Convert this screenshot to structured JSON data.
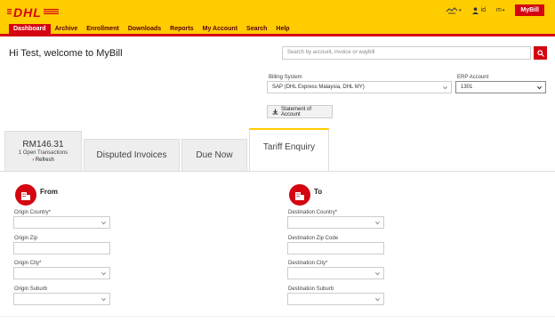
{
  "brand": {
    "logo_text": "DHL",
    "accent": "#d40511",
    "yellow": "#ffcc00"
  },
  "header": {
    "user_label": "id",
    "lang_label": "m",
    "mybill_label": "MyBill"
  },
  "nav": {
    "items": [
      {
        "label": "Dashboard"
      },
      {
        "label": "Archive"
      },
      {
        "label": "Enrollment"
      },
      {
        "label": "Downloads"
      },
      {
        "label": "Reports"
      },
      {
        "label": "My Account"
      },
      {
        "label": "Search"
      },
      {
        "label": "Help"
      }
    ]
  },
  "welcome": "Hi Test, welcome to MyBill",
  "search": {
    "placeholder": "Search by account, invoice or waybill"
  },
  "billing": {
    "label": "Billing System",
    "value": "SAP (DHL Express Malaysia, DHL MY)"
  },
  "erp": {
    "label": "ERP Account",
    "value": "1301"
  },
  "statement_button": "Statement of Account",
  "tabs": {
    "balance": {
      "amount": "RM146.31",
      "sub": "1 Open Transactions",
      "refresh": "Refresh"
    },
    "disputed": "Disputed Invoices",
    "due": "Due Now",
    "tariff": "Tariff Enquiry"
  },
  "from": {
    "title": "From",
    "country_label": "Origin Country*",
    "zip_label": "Origin Zip",
    "city_label": "Origin City*",
    "suburb_label": "Origin Suburb"
  },
  "to": {
    "title": "To",
    "country_label": "Destination Country*",
    "zip_label": "Destination Zip Code",
    "city_label": "Destination City*",
    "suburb_label": "Destination Suburb"
  }
}
